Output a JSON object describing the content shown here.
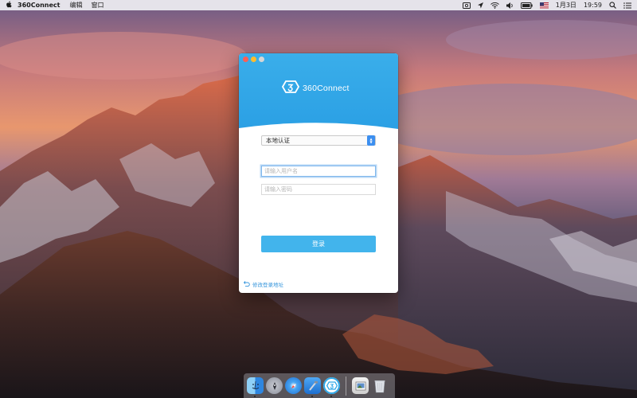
{
  "menubar": {
    "apple_glyph": "",
    "app_name": "360Connect",
    "menus": [
      "编辑",
      "窗口"
    ],
    "status_icons": [
      "screen-mirror-icon",
      "location-icon",
      "wifi-icon",
      "volume-icon",
      "battery-icon",
      "us-flag-icon",
      "search-icon",
      "notification-center-icon"
    ],
    "date": "1月3日",
    "time": "19:59"
  },
  "window": {
    "logo_text": "360Connect",
    "auth_method": "本地认证",
    "username_placeholder": "请输入用户名",
    "password_placeholder": "请输入密码",
    "login_label": "登录",
    "change_address_label": "修改登录地址"
  },
  "dock": {
    "apps": [
      "finder-icon",
      "launchpad-icon",
      "safari-icon",
      "xcode-icon",
      "360connect-icon",
      "preview-icon",
      "trash-icon"
    ]
  },
  "colors": {
    "header_blue": "#2fa8e8",
    "button_blue": "#42b4ec",
    "link_blue": "#3796dc",
    "close_red": "#fd5f57",
    "minimize_yellow": "#febc2e"
  }
}
